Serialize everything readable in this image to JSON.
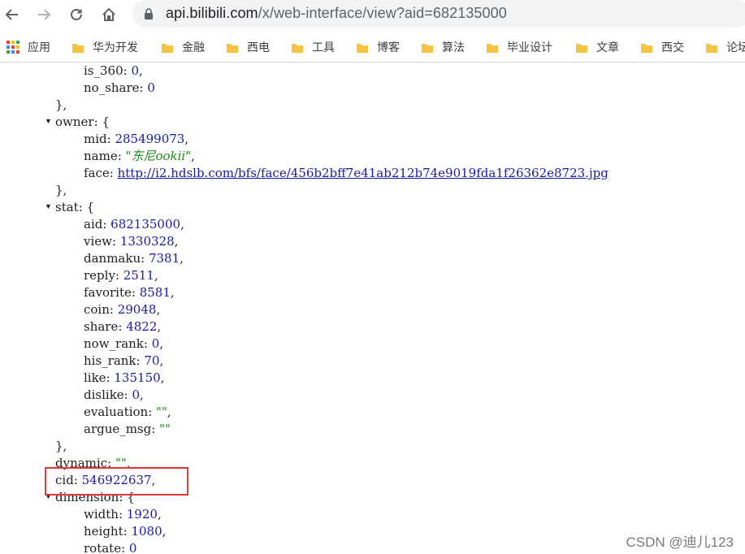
{
  "browser": {
    "url_host": "api.bilibili.com",
    "url_path": "/x/web-interface/view?aid=682135000",
    "bookmarks": [
      {
        "label": "应用",
        "icon": "apps-grid-icon"
      },
      {
        "label": "华为开发",
        "icon": "folder-icon"
      },
      {
        "label": "金融",
        "icon": "folder-icon"
      },
      {
        "label": "西电",
        "icon": "folder-icon"
      },
      {
        "label": "工具",
        "icon": "folder-icon"
      },
      {
        "label": "博客",
        "icon": "folder-icon"
      },
      {
        "label": "算法",
        "icon": "folder-icon"
      },
      {
        "label": "毕业设计",
        "icon": "folder-icon"
      },
      {
        "label": "文章",
        "icon": "folder-icon"
      },
      {
        "label": "西交",
        "icon": "folder-icon"
      },
      {
        "label": "论坛",
        "icon": "folder-icon"
      }
    ],
    "accent_folder_color": "#f4c542"
  },
  "json_view": {
    "lines": [
      {
        "indent": 2,
        "key": "is_360",
        "value": "0",
        "vtype": "num",
        "tail": ","
      },
      {
        "indent": 2,
        "key": "no_share",
        "value": "0",
        "vtype": "num",
        "tail": ""
      },
      {
        "indent": 1,
        "raw": "},"
      },
      {
        "indent": 1,
        "key": "owner",
        "value": "{",
        "vtype": "plain",
        "tail": "",
        "toggle": true
      },
      {
        "indent": 2,
        "key": "mid",
        "value": "285499073",
        "vtype": "num",
        "tail": ","
      },
      {
        "indent": 2,
        "key": "name",
        "value": "\"东尼ookii\"",
        "vtype": "str",
        "tail": ","
      },
      {
        "indent": 2,
        "key": "face",
        "value": "http://i2.hdslb.com/bfs/face/456b2bff7e41ab212b74e9019fda1f26362e8723.jpg",
        "vtype": "link",
        "tail": ""
      },
      {
        "indent": 1,
        "raw": "},"
      },
      {
        "indent": 1,
        "key": "stat",
        "value": "{",
        "vtype": "plain",
        "tail": "",
        "toggle": true
      },
      {
        "indent": 2,
        "key": "aid",
        "value": "682135000",
        "vtype": "num",
        "tail": ","
      },
      {
        "indent": 2,
        "key": "view",
        "value": "1330328",
        "vtype": "num",
        "tail": ","
      },
      {
        "indent": 2,
        "key": "danmaku",
        "value": "7381",
        "vtype": "num",
        "tail": ","
      },
      {
        "indent": 2,
        "key": "reply",
        "value": "2511",
        "vtype": "num",
        "tail": ","
      },
      {
        "indent": 2,
        "key": "favorite",
        "value": "8581",
        "vtype": "num",
        "tail": ","
      },
      {
        "indent": 2,
        "key": "coin",
        "value": "29048",
        "vtype": "num",
        "tail": ","
      },
      {
        "indent": 2,
        "key": "share",
        "value": "4822",
        "vtype": "num",
        "tail": ","
      },
      {
        "indent": 2,
        "key": "now_rank",
        "value": "0",
        "vtype": "num",
        "tail": ","
      },
      {
        "indent": 2,
        "key": "his_rank",
        "value": "70",
        "vtype": "num",
        "tail": ","
      },
      {
        "indent": 2,
        "key": "like",
        "value": "135150",
        "vtype": "num",
        "tail": ","
      },
      {
        "indent": 2,
        "key": "dislike",
        "value": "0",
        "vtype": "num",
        "tail": ","
      },
      {
        "indent": 2,
        "key": "evaluation",
        "value": "\"\"",
        "vtype": "str",
        "tail": ","
      },
      {
        "indent": 2,
        "key": "argue_msg",
        "value": "\"\"",
        "vtype": "str",
        "tail": ""
      },
      {
        "indent": 1,
        "raw": "},"
      },
      {
        "indent": 1,
        "key": "dynamic",
        "value": "\"\"",
        "vtype": "str",
        "tail": ","
      },
      {
        "indent": 1,
        "key": "cid",
        "value": "546922637",
        "vtype": "num",
        "tail": ",",
        "highlight": true
      },
      {
        "indent": 1,
        "key": "dimension",
        "value": "{",
        "vtype": "plain",
        "tail": "",
        "toggle": true
      },
      {
        "indent": 2,
        "key": "width",
        "value": "1920",
        "vtype": "num",
        "tail": ","
      },
      {
        "indent": 2,
        "key": "height",
        "value": "1080",
        "vtype": "num",
        "tail": ","
      },
      {
        "indent": 2,
        "key": "rotate",
        "value": "0",
        "vtype": "num",
        "tail": ""
      }
    ]
  },
  "watermark": "CSDN @迪儿123",
  "colors": {
    "key": "#202124",
    "number": "#1a1aa6",
    "string": "#1a8a1a",
    "highlight_box": "#e53935"
  }
}
